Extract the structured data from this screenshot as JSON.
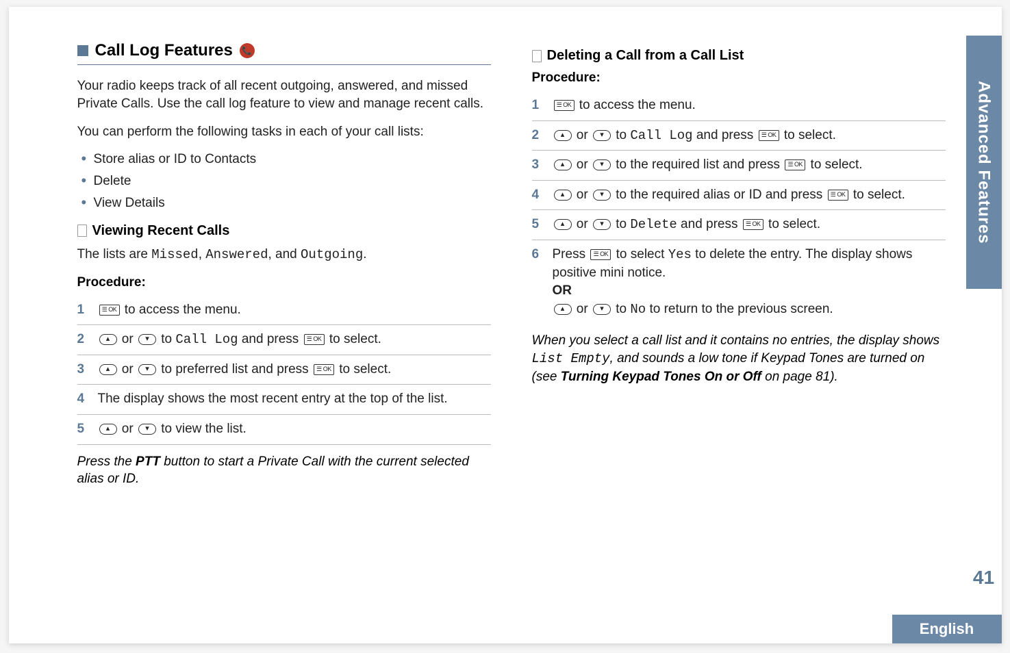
{
  "sideTab": "Advanced Features",
  "pageNumber": "41",
  "language": "English",
  "left": {
    "heading": "Call Log Features",
    "intro1": "Your radio keeps track of all recent outgoing, answered, and missed Private Calls. Use the call log feature to view and manage recent calls.",
    "intro2": "You can perform the following tasks in each of your call lists:",
    "bullets": [
      "Store alias or ID to Contacts",
      "Delete",
      "View Details"
    ],
    "sub1": {
      "title": "Viewing Recent Calls",
      "desc_pre": "The lists are ",
      "lists": "Missed",
      "lists2": "Answered",
      "lists3": "Outgoing",
      "procedure": "Procedure:",
      "steps": {
        "s1": " to access the menu.",
        "s2_mid": " to ",
        "s2_code": "Call Log",
        "s2_end": " and press ",
        "s2_fin": " to select.",
        "s3_mid": " to preferred list and press ",
        "s3_fin": " to select.",
        "s4": "The display shows the most recent entry at the top of the list.",
        "s5": " to view the list."
      },
      "note_pre": "Press the ",
      "note_ptt": "PTT",
      "note_post": " button to start a Private Call with the current selected alias or ID."
    }
  },
  "right": {
    "sub2": {
      "title": "Deleting a Call from a Call List",
      "procedure": "Procedure:",
      "steps": {
        "s1": " to access the menu.",
        "s2_mid": " to ",
        "s2_code": "Call Log",
        "s2_end": " and press ",
        "s2_fin": " to select.",
        "s3_mid": " to the required list and press ",
        "s3_fin": " to select.",
        "s4_mid": " to the required alias or ID and press ",
        "s4_fin": " to select.",
        "s5_mid": " to ",
        "s5_code": "Delete",
        "s5_end": " and press ",
        "s5_fin": " to select.",
        "s6_pre": "Press ",
        "s6_mid": " to select ",
        "s6_yes": "Yes",
        "s6_post": " to delete the entry. The display shows positive mini notice.",
        "s6_or": "OR",
        "s6_no_mid": " to ",
        "s6_no": "No",
        "s6_no_post": " to return to the previous screen."
      },
      "note_pre": "When you select a call list and it contains no entries, the display shows ",
      "note_code": "List Empty",
      "note_mid": ", and sounds a low tone if Keypad Tones are turned on (see ",
      "note_link": "Turning Keypad Tones On or Off",
      "note_page": " on page 81)."
    }
  },
  "or_word": " or "
}
